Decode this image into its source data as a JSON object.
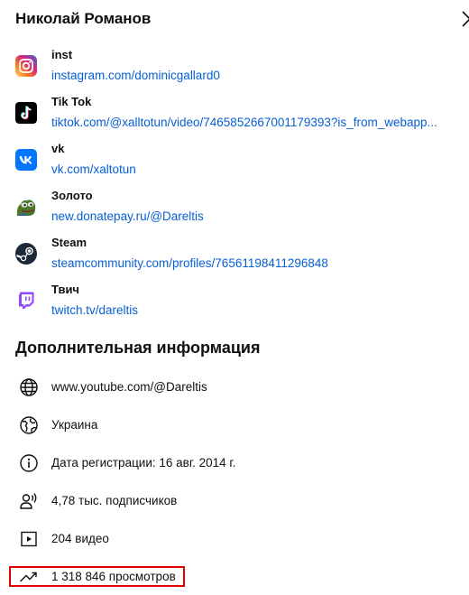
{
  "header": {
    "title": "Николай Романов",
    "close_icon": "close-icon"
  },
  "links": [
    {
      "name": "inst",
      "url": "instagram.com/dominicgallard0",
      "icon": "instagram-icon"
    },
    {
      "name": "Tik Tok",
      "url": "tiktok.com/@xalltotun/video/7465852667001179393?is_from_webapp...",
      "icon": "tiktok-icon"
    },
    {
      "name": "vk",
      "url": "vk.com/xaltotun",
      "icon": "vk-icon"
    },
    {
      "name": "Золото",
      "url": "new.donatepay.ru/@Dareltis",
      "icon": "pepe-frog-icon"
    },
    {
      "name": "Steam",
      "url": "steamcommunity.com/profiles/76561198411296848",
      "icon": "steam-icon"
    },
    {
      "name": "Твич",
      "url": "twitch.tv/dareltis",
      "icon": "twitch-icon"
    }
  ],
  "additional": {
    "title": "Дополнительная информация",
    "items": [
      {
        "text": "www.youtube.com/@Dareltis",
        "icon": "globe-icon"
      },
      {
        "text": "Украина",
        "icon": "globe-location-icon"
      },
      {
        "text": "Дата регистрации: 16 авг. 2014 г.",
        "icon": "info-icon"
      },
      {
        "text": "4,78 тыс. подписчиков",
        "icon": "subscribers-icon"
      },
      {
        "text": "204 видео",
        "icon": "video-icon"
      },
      {
        "text": "1 318 846 просмотров",
        "icon": "trending-icon"
      }
    ]
  },
  "colors": {
    "link": "#065fd4",
    "text": "#0f0f0f",
    "highlight": "#e00000"
  }
}
